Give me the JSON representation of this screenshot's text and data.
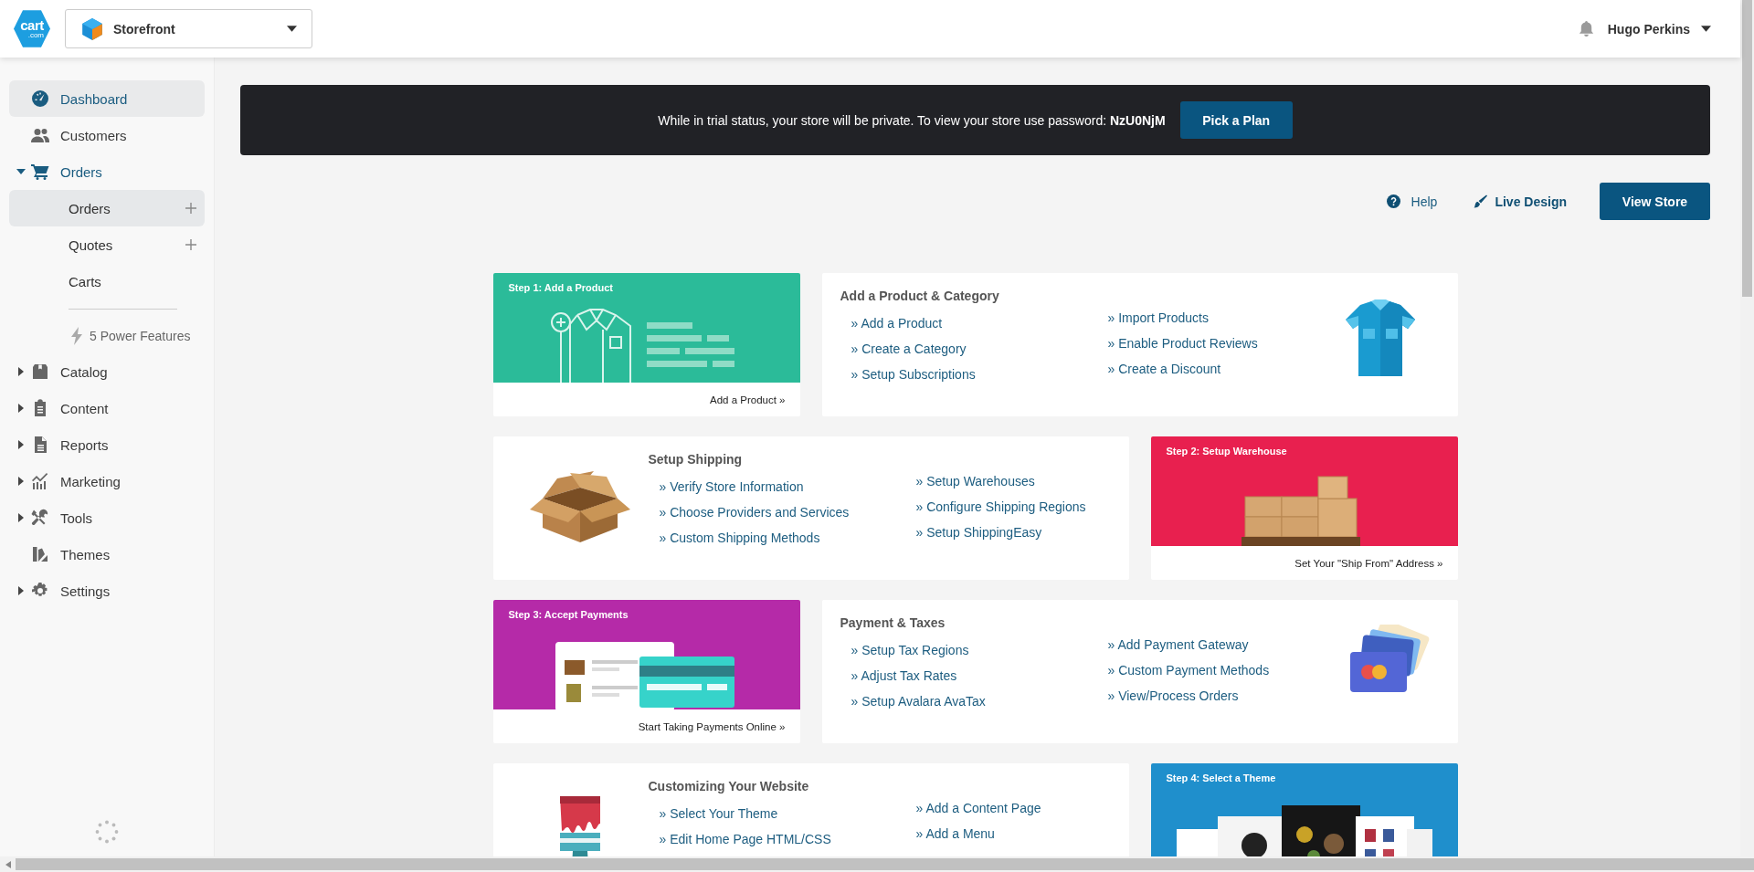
{
  "header": {
    "logo": {
      "text": "cart",
      "suffix": ".com"
    },
    "store_selector": {
      "value": "Storefront"
    },
    "user": {
      "name": "Hugo Perkins"
    }
  },
  "sidebar": {
    "items": [
      {
        "label": "Dashboard",
        "selected": true
      },
      {
        "label": "Customers",
        "selected": false
      },
      {
        "label": "Orders",
        "selected": false,
        "expanded": true,
        "children": [
          {
            "kind": "page",
            "label": "Orders",
            "selected": true,
            "addable": true
          },
          {
            "kind": "page",
            "label": "Quotes",
            "selected": false,
            "addable": true
          },
          {
            "kind": "page",
            "label": "Carts",
            "selected": false,
            "addable": false
          },
          {
            "kind": "feature",
            "label": "5 Power Features"
          }
        ]
      },
      {
        "label": "Catalog",
        "selected": false,
        "expanded": false
      },
      {
        "label": "Content",
        "selected": false,
        "expanded": false
      },
      {
        "label": "Reports",
        "selected": false,
        "expanded": false
      },
      {
        "label": "Marketing",
        "selected": false,
        "expanded": false
      },
      {
        "label": "Tools",
        "selected": false,
        "expanded": false
      },
      {
        "label": "Themes",
        "selected": false
      },
      {
        "label": "Settings",
        "selected": false,
        "expanded": false
      }
    ]
  },
  "banner": {
    "message": "While in trial status, your store will be private. To view your store use password: **NzU0NjM**",
    "button": "Pick a Plan"
  },
  "actions": {
    "help": "Help",
    "live_design": "Live Design",
    "view_store": "View Store"
  },
  "card_rows": [
    {
      "cards": [
        {
          "kind": "step",
          "title": "Step 1: Add a Product",
          "color": "#2bbb99",
          "link": "Add a Product »"
        },
        {
          "kind": "links",
          "title": "Add a Product & Category",
          "column_1": [
            "» Add a Product",
            "» Create a Category",
            "» Setup Subscriptions"
          ],
          "column_2": [
            "» Import Products",
            "» Enable Product Reviews",
            "» Create a Discount"
          ]
        }
      ]
    },
    {
      "cards": [
        {
          "kind": "links",
          "title": "Setup Shipping",
          "column_1": [
            "» Verify Store Information",
            "» Choose Providers and Services",
            "» Custom Shipping Methods"
          ],
          "column_2": [
            "» Setup Warehouses",
            "» Configure Shipping Regions",
            "» Setup ShippingEasy"
          ]
        },
        {
          "kind": "step",
          "title": "Step 2: Setup Warehouse",
          "color": "#e8204f",
          "link": "Set Your \"Ship From\" Address »"
        }
      ]
    },
    {
      "cards": [
        {
          "kind": "step",
          "title": "Step 3: Accept Payments",
          "color": "#b52aa8",
          "link": "Start Taking Payments Online »"
        },
        {
          "kind": "links",
          "title": "Payment & Taxes",
          "column_1": [
            "» Setup Tax Regions",
            "» Adjust Tax Rates",
            "» Setup Avalara AvaTax"
          ],
          "column_2": [
            "» Add Payment Gateway",
            "» Custom Payment Methods",
            "» View/Process Orders"
          ]
        }
      ]
    },
    {
      "cards": [
        {
          "kind": "links",
          "title": "Customizing Your Website",
          "column_1": [
            "» Select Your Theme",
            "» Edit Home Page HTML/CSS"
          ],
          "column_2": [
            "» Add a Content Page",
            "» Add a Menu"
          ]
        },
        {
          "kind": "step",
          "title": "Step 4: Select a Theme",
          "color": "#1f8fcc"
        }
      ]
    }
  ]
}
